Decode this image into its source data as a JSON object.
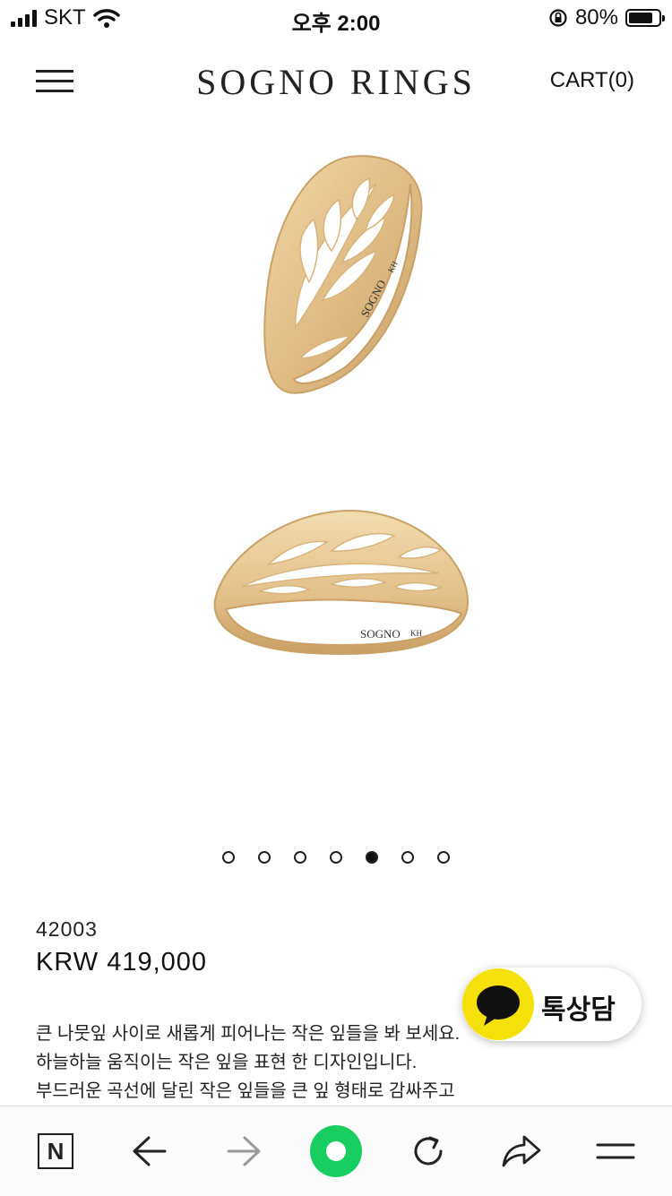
{
  "status_bar": {
    "carrier": "SKT",
    "time": "오후 2:00",
    "battery_percent": "80%",
    "battery_level": 0.8,
    "icons": [
      "signal-icon",
      "wifi-icon",
      "orientation-lock-icon",
      "battery-icon"
    ]
  },
  "header": {
    "brand": "SOGNO RINGS",
    "cart_label": "CART(0)",
    "menu_icon": "hamburger-menu-icon"
  },
  "carousel": {
    "engraving": "SOGNO",
    "hallmark": "KH",
    "slide_count": 7,
    "active_index": 4,
    "ring_color": "#e3c38e"
  },
  "product": {
    "sku": "42003",
    "price": "KRW 419,000",
    "description": [
      "큰 나뭇잎 사이로 새롭게 피어나는 작은 잎들을 봐 보세요.",
      "하늘하늘 움직이는 작은 잎을 표현 한 디자인입니다.",
      "부드러운 곡선에 달린 작은 잎들을 큰 잎 형태로 감싸주고"
    ]
  },
  "kakao": {
    "label": "톡상담",
    "color": "#f6e00a",
    "icon": "chat-bubble-icon"
  },
  "toolbar": {
    "items": [
      "naver-home-icon",
      "back-arrow-icon",
      "forward-arrow-icon",
      "green-circle-icon",
      "refresh-icon",
      "share-icon",
      "menu-icon"
    ],
    "accent": "#19ce60"
  }
}
